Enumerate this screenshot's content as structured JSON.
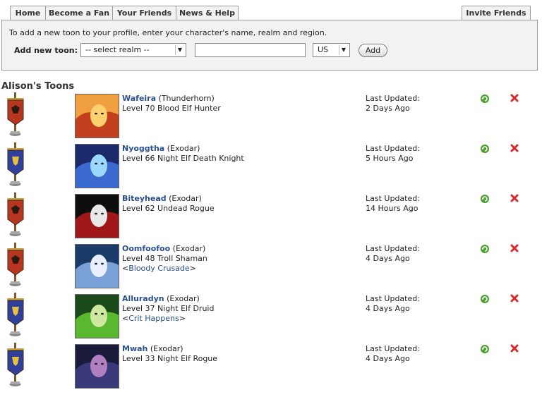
{
  "tabs": {
    "home": "Home",
    "become_fan": "Become a Fan",
    "your_friends": "Your Friends",
    "news_help": "News & Help",
    "invite_friends": "Invite Friends"
  },
  "add_toon": {
    "instructions": "To add a new toon to your profile, enter your character's name, realm and region.",
    "label": "Add new toon:",
    "realm_select": "-- select realm --",
    "name_value": "",
    "region_select": "US",
    "add_button": "Add"
  },
  "section_title": "Alison's Toons",
  "toons": [
    {
      "name": "Wafeira",
      "realm": "(Thunderhorn)",
      "details": "Level 70 Blood Elf Hunter",
      "guild": "",
      "updated_label": "Last Updated:",
      "updated_value": "2 Days Ago",
      "faction": "horde"
    },
    {
      "name": "Nyoggtha",
      "realm": "(Exodar)",
      "details": "Level 66 Night Elf Death Knight",
      "guild": "",
      "updated_label": "Last Updated:",
      "updated_value": "5 Hours Ago",
      "faction": "alliance"
    },
    {
      "name": "Biteyhead",
      "realm": "(Exodar)",
      "details": "Level 62 Undead Rogue",
      "guild": "",
      "updated_label": "Last Updated:",
      "updated_value": "14 Hours Ago",
      "faction": "horde"
    },
    {
      "name": "Oomfoofoo",
      "realm": "(Exodar)",
      "details": "Level 48 Troll Shaman",
      "guild": "Bloody Crusade",
      "updated_label": "Last Updated:",
      "updated_value": "4 Days Ago",
      "faction": "horde"
    },
    {
      "name": "Alluradyn",
      "realm": "(Exodar)",
      "details": "Level 37 Night Elf Druid",
      "guild": "Crit Happens",
      "updated_label": "Last Updated:",
      "updated_value": "4 Days Ago",
      "faction": "alliance"
    },
    {
      "name": "Mwah",
      "realm": "(Exodar)",
      "details": "Level 33 Night Elf Rogue",
      "guild": "",
      "updated_label": "Last Updated:",
      "updated_value": "4 Days Ago",
      "faction": "alliance"
    }
  ],
  "icons": {
    "refresh": "refresh-icon",
    "delete": "delete-icon",
    "horde_banner": "horde-banner-icon",
    "alliance_banner": "alliance-banner-icon",
    "dropdown": "chevron-down-icon"
  },
  "colors": {
    "link": "#2a4f8f",
    "horde": "#b8361f",
    "alliance": "#2f3f9a",
    "refresh": "#4aa02c",
    "delete": "#d62b2b",
    "panel_bg": "#f2f2f2"
  }
}
